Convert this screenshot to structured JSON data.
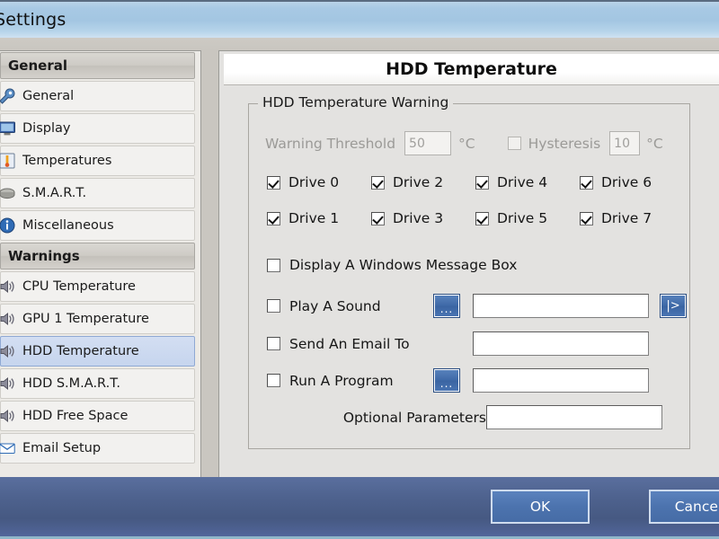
{
  "window": {
    "title": "Settings"
  },
  "sidebar": {
    "sections": [
      {
        "header": "General",
        "items": [
          {
            "label": "General",
            "icon": "wrench-icon",
            "selected": false
          },
          {
            "label": "Display",
            "icon": "monitor-icon",
            "selected": false
          },
          {
            "label": "Temperatures",
            "icon": "thermometer-icon",
            "selected": false
          },
          {
            "label": "S.M.A.R.T.",
            "icon": "harddisk-icon",
            "selected": false
          },
          {
            "label": "Miscellaneous",
            "icon": "info-icon",
            "selected": false
          }
        ]
      },
      {
        "header": "Warnings",
        "items": [
          {
            "label": "CPU Temperature",
            "icon": "speaker-icon",
            "selected": false
          },
          {
            "label": "GPU 1 Temperature",
            "icon": "speaker-icon",
            "selected": false
          },
          {
            "label": "HDD Temperature",
            "icon": "speaker-icon",
            "selected": true
          },
          {
            "label": "HDD S.M.A.R.T.",
            "icon": "speaker-icon",
            "selected": false
          },
          {
            "label": "HDD Free Space",
            "icon": "speaker-icon",
            "selected": false
          },
          {
            "label": "Email Setup",
            "icon": "envelope-icon",
            "selected": false
          }
        ]
      }
    ]
  },
  "main": {
    "title": "HDD Temperature",
    "groupbox": {
      "title": "HDD Temperature Warning",
      "threshold": {
        "label": "Warning Threshold",
        "value": "50",
        "unit": "°C",
        "enabled": false
      },
      "hysteresis": {
        "label": "Hysteresis",
        "value": "10",
        "unit": "°C",
        "checked": false,
        "enabled": false
      },
      "drives": [
        {
          "label": "Drive 0",
          "checked": true
        },
        {
          "label": "Drive 1",
          "checked": true
        },
        {
          "label": "Drive 2",
          "checked": true
        },
        {
          "label": "Drive 3",
          "checked": true
        },
        {
          "label": "Drive 4",
          "checked": true
        },
        {
          "label": "Drive 5",
          "checked": true
        },
        {
          "label": "Drive 6",
          "checked": true
        },
        {
          "label": "Drive 7",
          "checked": true
        }
      ],
      "actions": {
        "message_box": {
          "label": "Display A Windows Message Box",
          "checked": false
        },
        "play_sound": {
          "label": "Play A Sound",
          "checked": false,
          "value": "",
          "browse_label": "...",
          "preview_label": "|>"
        },
        "send_email": {
          "label": "Send An Email To",
          "checked": false,
          "value": ""
        },
        "run_program": {
          "label": "Run A Program",
          "checked": false,
          "value": "",
          "browse_label": "..."
        },
        "optional_parameters": {
          "label": "Optional Parameters",
          "value": ""
        }
      }
    }
  },
  "footer": {
    "ok_label": "OK",
    "cancel_label": "Cancel"
  },
  "colors": {
    "titlebar": "#a8c9e4",
    "footer": "#4e628e",
    "accent_blue": "#4c73ae",
    "selection": "#c6d5ee"
  }
}
